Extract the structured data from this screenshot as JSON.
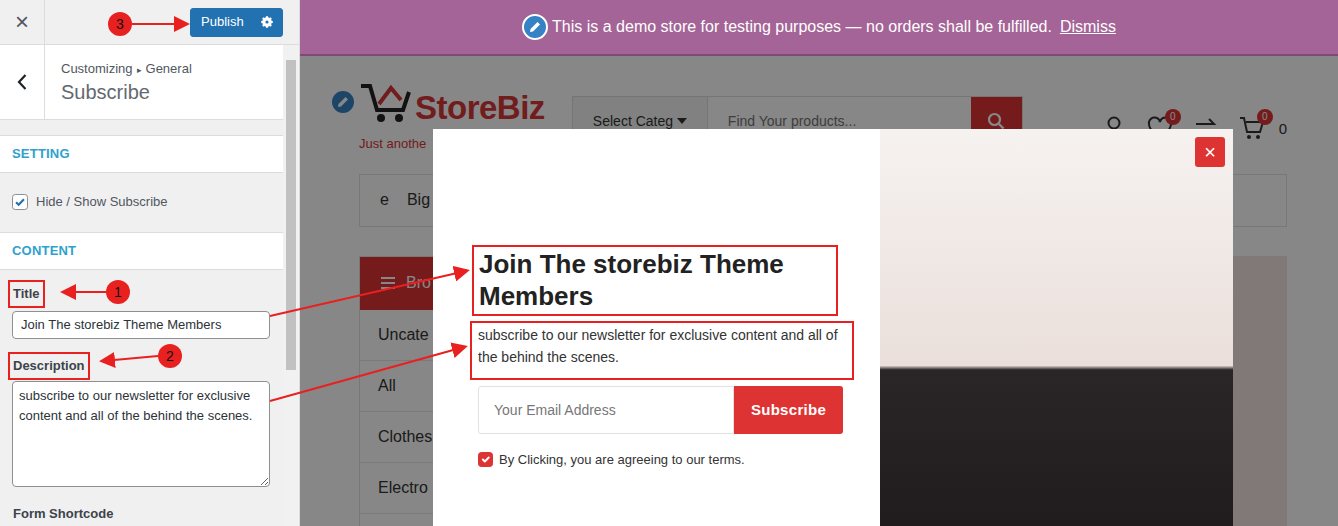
{
  "customizer": {
    "close": "×",
    "publish": "Publish",
    "breadcrumb": {
      "parent": "Customizing",
      "separator": "▸",
      "section": "General"
    },
    "title": "Subscribe",
    "setting_heading": "SETTING",
    "toggle": {
      "label": "Hide / Show Subscribe",
      "checked": true
    },
    "content_heading": "CONTENT",
    "fields": [
      {
        "kind": "input",
        "label": "Title",
        "value": "Join The storebiz Theme Members",
        "highlighted": true
      },
      {
        "kind": "textarea",
        "label": "Description",
        "value": "subscribe to our newsletter for exclusive content and all of the behind the scenes.",
        "highlighted": true
      },
      {
        "kind": "label",
        "label": "Form Shortcode",
        "highlighted": false
      }
    ]
  },
  "annotations": [
    {
      "number": "1"
    },
    {
      "number": "2"
    },
    {
      "number": "3"
    }
  ],
  "notice": {
    "text": "This is a demo store for testing purposes — no orders shall be fulfilled.",
    "link": "Dismiss"
  },
  "site": {
    "logo": "StoreBiz",
    "tagline": "Just anothe",
    "category_select": "Select Categ",
    "search_placeholder": "Find Your products...",
    "wishlist_count": "0",
    "cart_count": "0",
    "cart_total": "0",
    "nav": [
      "e",
      "Big"
    ],
    "sidebar_header": "Bro",
    "categories": [
      "Uncate",
      "All",
      "Clothes",
      "Electro"
    ]
  },
  "modal": {
    "close": "×",
    "title": "Join The storebiz Theme Members",
    "description": "subscribe to our newsletter for exclusive content and all of the behind the scenes.",
    "email_placeholder": "Your Email Address",
    "button": "Subscribe",
    "consent": {
      "label": "By Clicking, you are agreeing to our terms.",
      "checked": true
    }
  }
}
